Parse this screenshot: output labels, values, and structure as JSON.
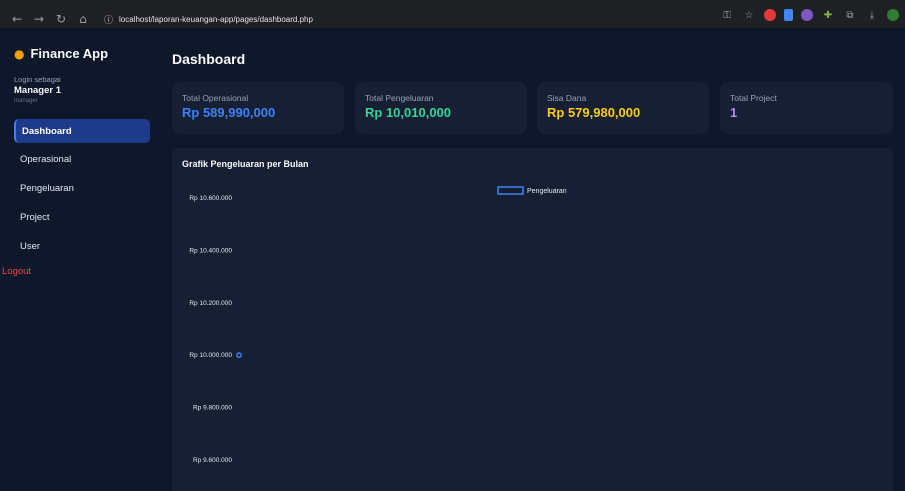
{
  "browser": {
    "url": "localhost/laporan-keuangan-app/pages/dashboard.php"
  },
  "sidebar": {
    "brand": "Finance App",
    "login_label": "Login sebagai",
    "user_name": "Manager 1",
    "user_role": "manager",
    "items": [
      {
        "label": "Dashboard",
        "active": true
      },
      {
        "label": "Operasional",
        "active": false
      },
      {
        "label": "Pengeluaran",
        "active": false
      },
      {
        "label": "Project",
        "active": false
      },
      {
        "label": "User",
        "active": false
      }
    ],
    "logout": "Logout"
  },
  "main": {
    "title": "Dashboard",
    "cards": [
      {
        "label": "Total Operasional",
        "value": "Rp 589,990,000",
        "color": "#3b82f6"
      },
      {
        "label": "Total Pengeluaran",
        "value": "Rp 10,010,000",
        "color": "#34d399"
      },
      {
        "label": "Sisa Dana",
        "value": "Rp 579,980,000",
        "color": "#facc15"
      },
      {
        "label": "Total Project",
        "value": "1",
        "color": "#c084fc"
      }
    ]
  },
  "chart_data": {
    "type": "line",
    "title": "Grafik Pengeluaran per Bulan",
    "series": [
      {
        "name": "Pengeluaran",
        "color": "#3b82f6",
        "values": [
          10000000
        ]
      }
    ],
    "yticks": [
      "Rp 10.600.000",
      "Rp 10.400.000",
      "Rp 10.200.000",
      "Rp 10.000.000",
      "Rp 9.800.000",
      "Rp 9.600.000"
    ],
    "ytick_values": [
      10600000,
      10400000,
      10200000,
      10000000,
      9800000,
      9600000
    ],
    "legend_position": "top-center",
    "grid": false
  }
}
